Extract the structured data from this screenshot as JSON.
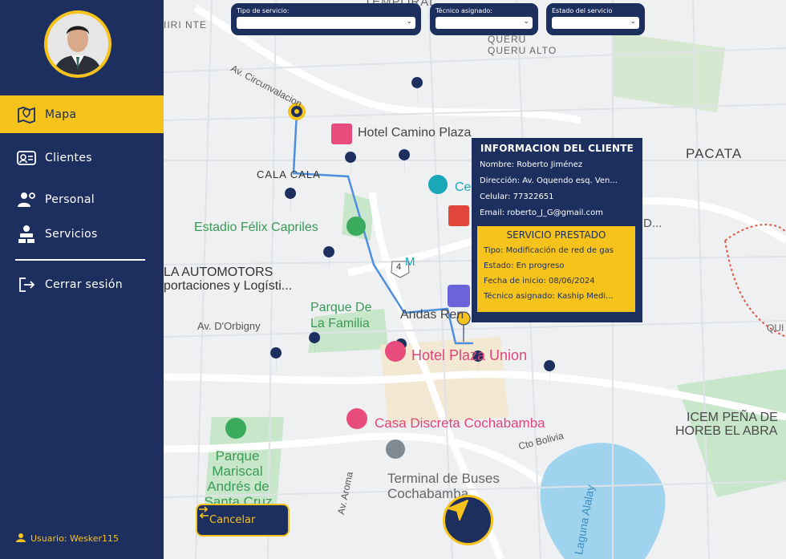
{
  "sidebar": {
    "items": [
      {
        "label": "Mapa",
        "icon": "map-icon"
      },
      {
        "label": "Clientes",
        "icon": "id-card-icon"
      },
      {
        "label": "Personal",
        "icon": "user-gear-icon"
      },
      {
        "label": "Servicios",
        "icon": "service-tools-icon"
      },
      {
        "label": "Cerrar sesión",
        "icon": "logout-icon"
      }
    ],
    "active": "Mapa",
    "user_label": "Usuario: Wesker115"
  },
  "filters": {
    "service_type_label": "Tipo de servicio:",
    "service_type_value": "",
    "technician_label": "Técnico asignado:",
    "technician_value": "",
    "status_label": "Estado del servicio",
    "status_value": ""
  },
  "client_card": {
    "title": "INFORMACION DEL CLIENTE",
    "name": "Nombre: Roberto Jiménez",
    "address": "Dirección: Av. Oquendo esq. Ven...",
    "phone": "Celular: 77322651",
    "email": "Email: roberto_J_G@gmail.com",
    "service": {
      "title": "SERVICIO PRESTADO",
      "type": "Tipo: Modificación de red de gas",
      "status": "Estado: En progreso",
      "start": "Fecha de inicio: 08/06/2024",
      "technician": "Técnico asignado: Kaship Medi..."
    }
  },
  "map_labels": {
    "hotel_camino": "Hotel Camino Plaza",
    "cala_cala": "CALA CALA",
    "estadio": "Estadio Félix Capriles",
    "automotors": "LA AUTOMOTORS",
    "importaciones": "portaciones y Logísti...",
    "parque_familia_1": "Parque De",
    "parque_familia_2": "La Familia",
    "av_orbigny": "Av. D'Orbigny",
    "andes": "Andas Ren",
    "hotel_plaza": "Hotel Plaza Union",
    "casa_discreta": "Casa Discreta Cochabamba",
    "parque_mariscal_1": "Parque",
    "parque_mariscal_2": "Mariscal",
    "parque_mariscal_3": "Andrés de",
    "parque_mariscal_4": "Santa Cruz",
    "terminal_1": "Terminal de Buses",
    "terminal_2": "Cochabamba",
    "pacata": "PACATA",
    "queru": "QUERU",
    "queru_alto": "QUERU ALTO",
    "icem_1": "ICEM PEÑA DE",
    "icem_2": "HOREB EL ABRA",
    "circunvalacion": "Av. Circunvalacion",
    "cto_bolivia": "Cto Bolivia",
    "laguna": "Laguna Alalay",
    "av_aroma": "Av. Aroma",
    "temporal": "TEMPORAL",
    "iri_nte": "IIRI NTE",
    "ce": "Ce",
    "m": "M",
    "d": "D...",
    "qui": "QUI",
    "road_4": "4"
  },
  "buttons": {
    "cancel": "Cancelar"
  },
  "colors": {
    "primary": "#1c2f5e",
    "accent": "#f6c21c",
    "route": "#4f8fe0"
  }
}
